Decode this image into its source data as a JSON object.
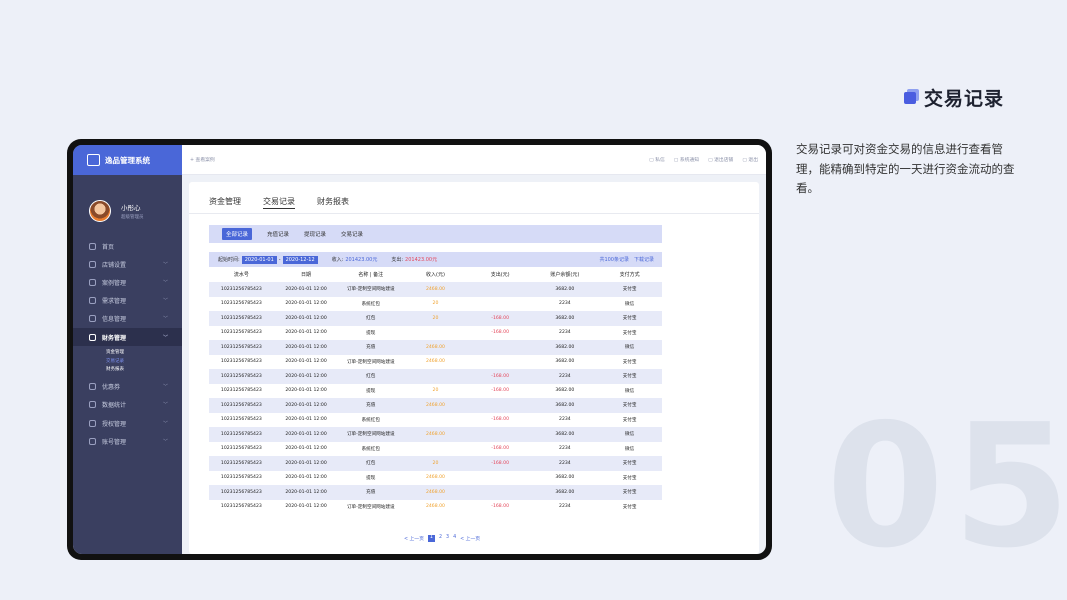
{
  "slide": {
    "title": "交易记录",
    "description": "交易记录可对资金交易的信息进行查看管理，能精确到特定的一天进行资金流动的查看。",
    "number": "05"
  },
  "app": {
    "brand": "逸品管理系统",
    "profile": {
      "name": "小彤心",
      "role": "超级管理员"
    },
    "menu": [
      {
        "label": "首页"
      },
      {
        "label": "店铺设置"
      },
      {
        "label": "案例管理"
      },
      {
        "label": "需求管理"
      },
      {
        "label": "信息管理"
      },
      {
        "label": "财务管理"
      },
      {
        "label": "优惠券"
      },
      {
        "label": "数据统计"
      },
      {
        "label": "授权管理"
      },
      {
        "label": "账号管理"
      }
    ],
    "submenu": [
      "资金管理",
      "交易记录",
      "财务报表"
    ],
    "topbar": {
      "left": "+ 查看案例",
      "right": [
        "私信",
        "系统通知",
        "退出店铺",
        "退出"
      ]
    }
  },
  "page": {
    "tabs": [
      "资金管理",
      "交易记录",
      "财务报表"
    ],
    "filters": [
      "全部记录",
      "充值记录",
      "提现记录",
      "交易记录"
    ],
    "summary": {
      "start_label": "起始时间:",
      "start_date": "2020-01-01",
      "sep": "-",
      "end_date": "2020-12-12",
      "income_label": "收入:",
      "income": "201423.00元",
      "expense_label": "支出:",
      "expense": "201423.00元",
      "total": "共100条记录",
      "download": "下载记录"
    },
    "columns": [
      "流水号",
      "日期",
      "名称 | 备注",
      "收入(元)",
      "支出(元)",
      "账户余额(元)",
      "支付方式"
    ],
    "rows": [
      [
        "10231256785423",
        "2020-01-01 12:00",
        "订单-定制空间网站建设",
        "2468.00",
        "",
        "3682.00",
        "支付宝"
      ],
      [
        "10231256785423",
        "2020-01-01 12:00",
        "系统红包",
        "20",
        "",
        "2234",
        "微信"
      ],
      [
        "10231256785423",
        "2020-01-01 12:00",
        "红包",
        "20",
        "-168.00",
        "3682.00",
        "支付宝"
      ],
      [
        "10231256785423",
        "2020-01-01 12:00",
        "提现",
        "",
        "-168.00",
        "2234",
        "支付宝"
      ],
      [
        "10231256785423",
        "2020-01-01 12:00",
        "充值",
        "2468.00",
        "",
        "3682.00",
        "微信"
      ],
      [
        "10231256785423",
        "2020-01-01 12:00",
        "订单-定制空间网站建设",
        "2468.00",
        "",
        "3682.00",
        "支付宝"
      ],
      [
        "10231256785423",
        "2020-01-01 12:00",
        "红包",
        "",
        "-168.00",
        "2234",
        "支付宝"
      ],
      [
        "10231256785423",
        "2020-01-01 12:00",
        "提现",
        "20",
        "-168.00",
        "3682.00",
        "微信"
      ],
      [
        "10231256785423",
        "2020-01-01 12:00",
        "充值",
        "2468.00",
        "",
        "3682.00",
        "支付宝"
      ],
      [
        "10231256785423",
        "2020-01-01 12:00",
        "系统红包",
        "",
        "-168.00",
        "2234",
        "支付宝"
      ],
      [
        "10231256785423",
        "2020-01-01 12:00",
        "订单-定制空间网站建设",
        "2468.00",
        "",
        "3682.00",
        "微信"
      ],
      [
        "10231256785423",
        "2020-01-01 12:00",
        "系统红包",
        "",
        "-168.00",
        "2234",
        "微信"
      ],
      [
        "10231256785423",
        "2020-01-01 12:00",
        "红包",
        "20",
        "-168.00",
        "2234",
        "支付宝"
      ],
      [
        "10231256785423",
        "2020-01-01 12:00",
        "提现",
        "2468.00",
        "",
        "3682.00",
        "支付宝"
      ],
      [
        "10231256785423",
        "2020-01-01 12:00",
        "充值",
        "2468.00",
        "",
        "3682.00",
        "支付宝"
      ],
      [
        "10231256785423",
        "2020-01-01 12:00",
        "订单-定制空间网站建设",
        "2468.00",
        "-168.00",
        "2234",
        "支付宝"
      ]
    ],
    "pager": {
      "prev": "< 上一页",
      "pages": [
        "1",
        "2",
        "3",
        "4"
      ],
      "next": "< 上一页"
    }
  },
  "colors": {
    "accent": "#4a67d8",
    "sidebar": "#3a3f60",
    "income": "#f0a22e",
    "expense": "#e4475b"
  }
}
